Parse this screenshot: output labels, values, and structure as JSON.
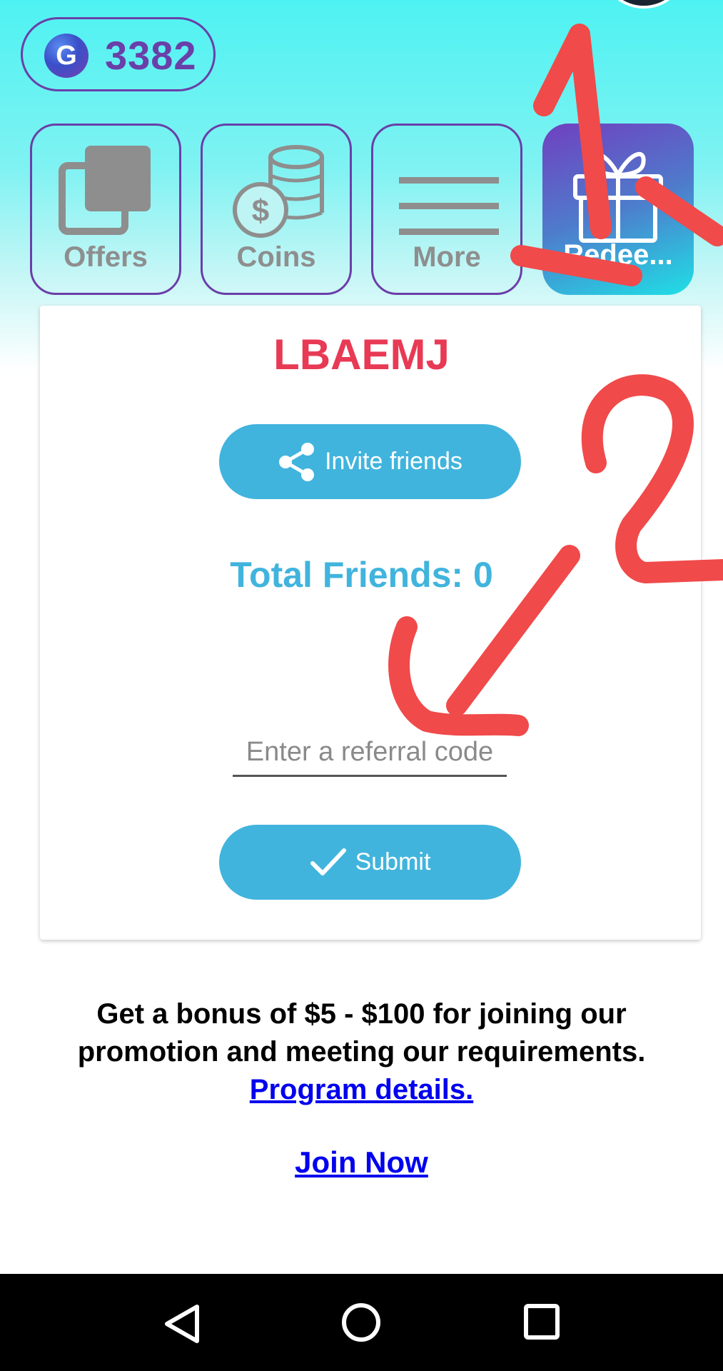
{
  "header": {
    "balance": "3382",
    "currency_icon": "g-coin-icon",
    "currency_letter": "G"
  },
  "tabs": [
    {
      "label": "Offers",
      "icon": "cards-icon"
    },
    {
      "label": "Coins",
      "icon": "coins-stack-icon"
    },
    {
      "label": "More",
      "icon": "menu-lines-icon"
    },
    {
      "label": "Redee...",
      "icon": "gift-icon",
      "active": true
    }
  ],
  "referral": {
    "code": "LBAEMJ",
    "invite_label": "Invite friends",
    "total_friends": "Total Friends: 0",
    "input_placeholder": "Enter a referral code",
    "input_value": "",
    "submit_label": "Submit"
  },
  "promo": {
    "text": "Get a bonus of $5 - $100 for joining our promotion and meeting our requirements.",
    "details_link": "Program details.",
    "join_link": "Join Now"
  },
  "annotations": [
    "1",
    "2"
  ],
  "colors": {
    "accent_purple": "#6a3fa8",
    "button_blue": "#41b4dd",
    "code_red": "#e83a55",
    "annotation_red": "#f04a4a",
    "link_blue": "#0000ee"
  },
  "system_nav": [
    "back-icon",
    "home-icon",
    "recents-icon"
  ]
}
